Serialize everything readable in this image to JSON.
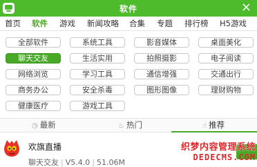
{
  "header": {
    "title": "软件",
    "logo_icon": "app-logo-icon",
    "close_symbol": "×",
    "color": "#4dbb2b"
  },
  "nav": {
    "items": [
      {
        "label": "首页",
        "active": false
      },
      {
        "label": "软件",
        "active": true
      },
      {
        "label": "游戏",
        "active": false
      },
      {
        "label": "新闻攻略",
        "active": false
      },
      {
        "label": "合集",
        "active": false
      },
      {
        "label": "专题",
        "active": false
      },
      {
        "label": "排行榜",
        "active": false
      },
      {
        "label": "H5游戏",
        "active": false
      }
    ]
  },
  "categories": {
    "rows": [
      [
        "全部软件",
        "系统工具",
        "影音媒体",
        "桌面美化"
      ],
      [
        "聊天交友",
        "生活实用",
        "拍照摄影",
        "电子阅读"
      ],
      [
        "网络浏览",
        "学习工具",
        "通信增强",
        "交通出行"
      ],
      [
        "商务办公",
        "安全杀毒",
        "图形图像",
        "理财购物"
      ],
      [
        "健康医疗",
        "游戏工具"
      ]
    ],
    "selected": "聊天交友",
    "accent": "#48a928"
  },
  "tabs": {
    "items": [
      {
        "label": "最新",
        "icon": "clock-icon",
        "active": false
      },
      {
        "label": "热门",
        "icon": "flame-icon",
        "active": false
      },
      {
        "label": "推荐",
        "icon": "thumbs-up-icon",
        "active": true
      }
    ]
  },
  "app_item": {
    "name": "欢旗直播",
    "category": "聊天交友",
    "version": "V5.4.0",
    "size": "51.06M",
    "icon": "red-monster-app-icon"
  },
  "watermark": {
    "line1": "织梦内容管理系统",
    "line2": "DEDECMS.COM"
  }
}
